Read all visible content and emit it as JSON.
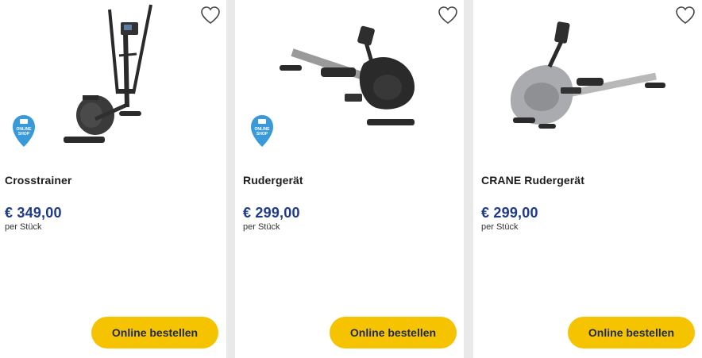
{
  "products": [
    {
      "title": "Crosstrainer",
      "price": "€ 349,00",
      "unit": "per Stück",
      "button_label": "Online bestellen",
      "badge": "online-shop",
      "image": "crosstrainer-image"
    },
    {
      "title": "Rudergerät",
      "price": "€ 299,00",
      "unit": "per Stück",
      "button_label": "Online bestellen",
      "badge": "online-shop",
      "image": "rowing-machine-image"
    },
    {
      "title": "CRANE Rudergerät",
      "price": "€ 299,00",
      "unit": "per Stück",
      "button_label": "Online bestellen",
      "badge": null,
      "image": "crane-rowing-machine-image"
    }
  ],
  "badge_text": [
    "ONLINE",
    "SHOP"
  ],
  "colors": {
    "price": "#1e3a8a",
    "button_bg": "#f5c300",
    "button_text": "#1e2a55",
    "badge": "#3a9ad9"
  },
  "icons": {
    "favorite": "heart-outline-icon"
  }
}
